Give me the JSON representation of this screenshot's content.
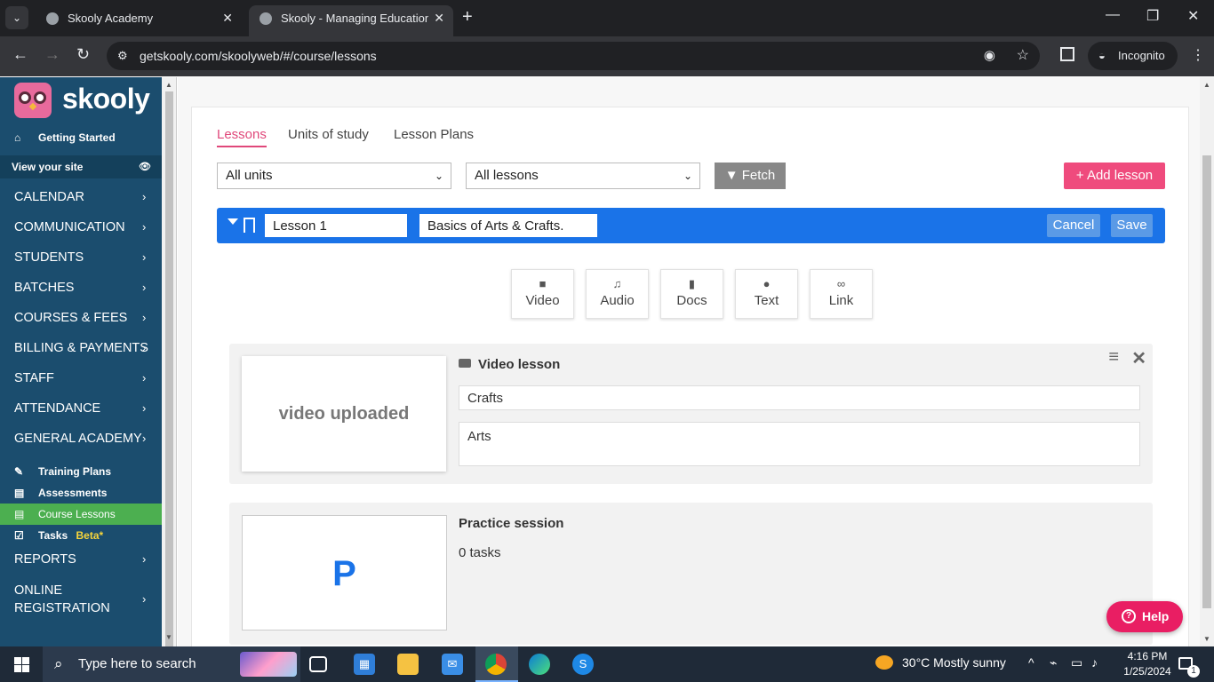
{
  "browser": {
    "tabs": [
      {
        "title": "Skooly Academy"
      },
      {
        "title": "Skooly - Managing Educational"
      }
    ],
    "url": "getskooly.com/skoolyweb/#/course/lessons",
    "incognito_label": "Incognito"
  },
  "sidebar": {
    "logo_text": "skooly",
    "getting_started": "Getting Started",
    "view_site": "View your site",
    "menu": [
      {
        "label": "CALENDAR"
      },
      {
        "label": "COMMUNICATION"
      },
      {
        "label": "STUDENTS"
      },
      {
        "label": "BATCHES"
      },
      {
        "label": "COURSES & FEES"
      },
      {
        "label": "BILLING & PAYMENTS"
      },
      {
        "label": "STAFF"
      },
      {
        "label": "ATTENDANCE"
      },
      {
        "label": "GENERAL ACADEMY"
      }
    ],
    "submenu": [
      {
        "label": "Training Plans"
      },
      {
        "label": "Assessments"
      },
      {
        "label": "Course Lessons"
      },
      {
        "label": "Tasks"
      }
    ],
    "tasks_badge": "Beta*",
    "reports": "REPORTS",
    "online_registration_line1": "ONLINE",
    "online_registration_line2": "REGISTRATION"
  },
  "main": {
    "tabs": [
      {
        "label": "Lessons"
      },
      {
        "label": "Units of study"
      },
      {
        "label": "Lesson Plans"
      }
    ],
    "units_select": "All units",
    "lessons_select": "All lessons",
    "fetch_label": "Fetch",
    "add_lesson_label": "Add lesson",
    "lesson": {
      "name": "Lesson 1",
      "description": "Basics of Arts & Crafts.",
      "cancel_label": "Cancel",
      "save_label": "Save"
    },
    "media_buttons": [
      {
        "label": "Video",
        "icon": "video-icon"
      },
      {
        "label": "Audio",
        "icon": "headphones-icon"
      },
      {
        "label": "Docs",
        "icon": "document-icon"
      },
      {
        "label": "Text",
        "icon": "comment-icon"
      },
      {
        "label": "Link",
        "icon": "link-icon"
      }
    ],
    "video_block": {
      "thumb_text": "video uploaded",
      "title": "Video lesson",
      "title_field": "Crafts",
      "description_field": "Arts"
    },
    "practice_block": {
      "thumb_letter": "P",
      "title": "Practice session",
      "tasks_count": "0 tasks"
    },
    "help_label": "Help"
  },
  "taskbar": {
    "search_placeholder": "Type here to search",
    "weather": "30°C  Mostly sunny",
    "time": "4:16 PM",
    "date": "1/25/2024",
    "notification_count": "1"
  },
  "colors": {
    "sidebar_bg": "#1b4d6e",
    "active_green": "#4caf50",
    "accent_pink": "#ef4b7d",
    "lesson_blue": "#1a73e8"
  }
}
